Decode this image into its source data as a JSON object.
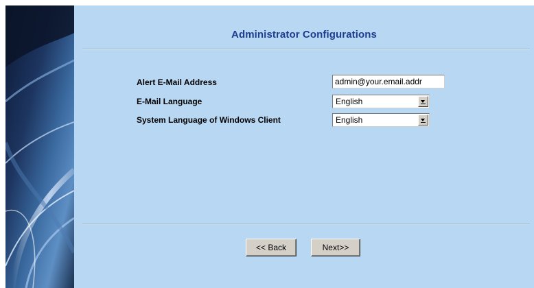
{
  "page": {
    "title": "Administrator Configurations"
  },
  "form": {
    "alert_email": {
      "label": "Alert E-Mail Address",
      "value": "admin@your.email.addr"
    },
    "email_language": {
      "label": "E-Mail Language",
      "value": "English"
    },
    "system_language": {
      "label": "System Language of Windows Client",
      "value": "English"
    }
  },
  "buttons": {
    "back": "<< Back",
    "next": "Next>>"
  },
  "colors": {
    "panel_background": "#b8d7f3",
    "title": "#1d3d8f",
    "side_art_dark": "#0a1730"
  }
}
